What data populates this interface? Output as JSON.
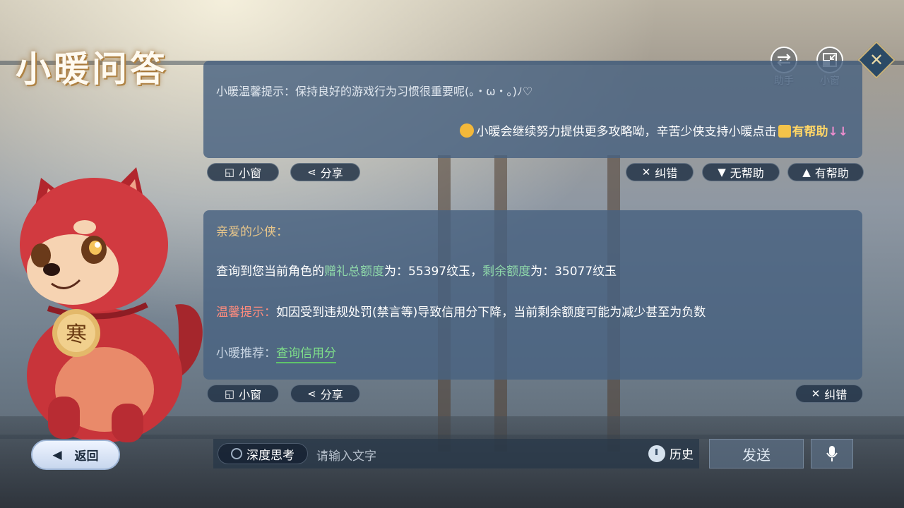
{
  "app": {
    "title": "小暖问答"
  },
  "top_buttons": {
    "assistant_label": "助手",
    "mini_window_label": "小窗"
  },
  "panel1": {
    "tip": "小暖温馨提示：保持良好的游戏行为习惯很重要呢(｡・ω・｡)ﾉ♡",
    "thanks_pre": "小暖会继续努力提供更多攻略呦，辛苦少侠支持小暖点击",
    "thanks_helpful": "有帮助",
    "thanks_arrows": "↓↓"
  },
  "actions1": {
    "mini_window": "小窗",
    "share": "分享",
    "correct": "纠错",
    "not_helpful": "无帮助",
    "helpful": "有帮助"
  },
  "panel2": {
    "greeting": "亲爱的少侠：",
    "query_pre": "查询到您当前角色的",
    "gift_total_label": "赠礼总额度",
    "gift_total_sep": "为：",
    "gift_total_value": "55397纹玉，",
    "remaining_label": "剩余额度",
    "remaining_sep": "为：",
    "remaining_value": "35077纹玉",
    "warn_label": "温馨提示：",
    "warn_text": "如因受到违规处罚(禁言等)导致信用分下降，当前剩余额度可能为减少甚至为负数",
    "rec_label": "小暖推荐：",
    "rec_link": "查询信用分"
  },
  "actions2": {
    "mini_window": "小窗",
    "share": "分享",
    "correct": "纠错"
  },
  "bottom": {
    "back": "返回",
    "deep_think": "深度思考",
    "input_placeholder": "请输入文字",
    "history": "历史",
    "send": "发送"
  },
  "mascot": {
    "tag_text": "寒"
  },
  "colors": {
    "panel": "#48627f",
    "accent_gold": "#ffd667",
    "link_green": "#7fe08a",
    "warn_red": "#ff8c7d"
  }
}
